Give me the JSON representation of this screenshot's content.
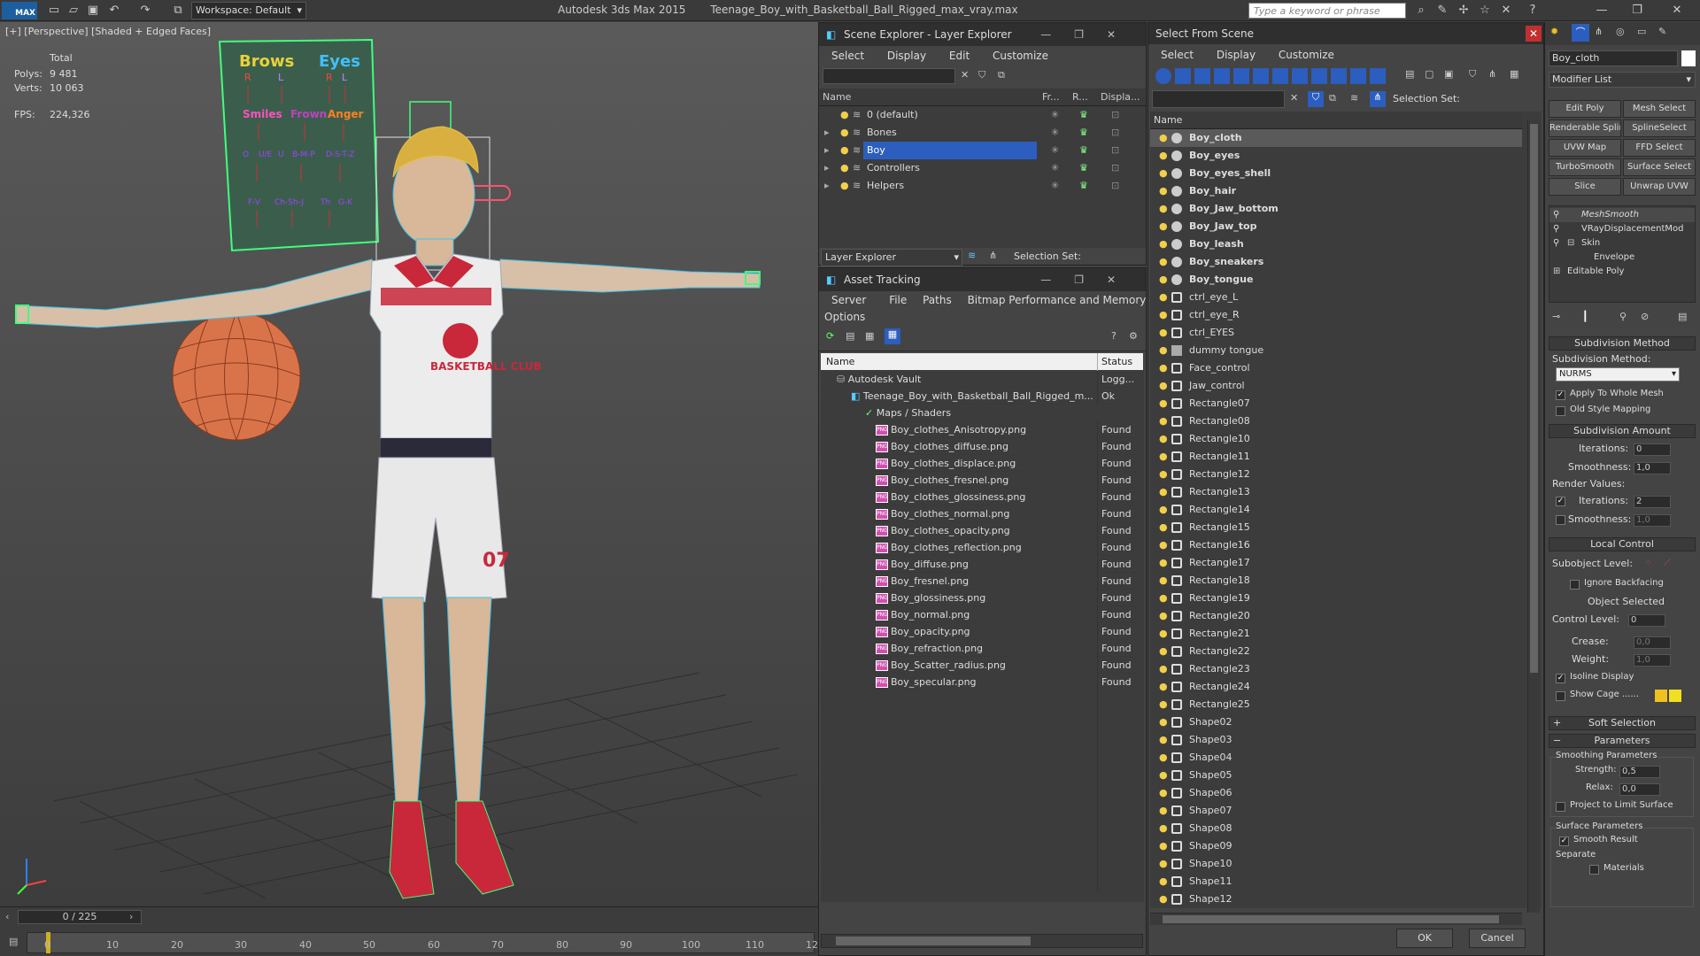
{
  "app": {
    "logo": "MAX",
    "title": "Autodesk 3ds Max  2015",
    "filename": "Teenage_Boy_with_Basketball_Ball_Rigged_max_vray.max",
    "workspace": "Workspace: Default",
    "search_placeholder": "Type a keyword or phrase"
  },
  "viewport": {
    "label": "[+] [Perspective] [Shaded + Edged Faces]",
    "stats": {
      "total_label": "Total",
      "polys_label": "Polys:",
      "polys_value": "9 481",
      "verts_label": "Verts:",
      "verts_value": "10 063",
      "fps_label": "FPS:",
      "fps_value": "224,326"
    },
    "face_board": {
      "brows": "Brows",
      "eyes": "Eyes",
      "r1": "R",
      "l1": "L",
      "r2": "R",
      "l2": "L",
      "smiles": "Smiles",
      "frown": "Frown",
      "anger": "Anger",
      "phon1": "O",
      "phon2": "U/E",
      "phon3": "U",
      "phon4": "B-M-P",
      "phon5": "D-S-T-Z",
      "phon6": "F-V",
      "phon7": "Ch-Sh-J",
      "phon8": "Th",
      "phon9": "G-K"
    },
    "shirt_text": "BASKETBALL CLUB",
    "shorts_number": "07"
  },
  "timeline": {
    "slider": "0 / 225",
    "ticks": [
      "0",
      "10",
      "20",
      "30",
      "40",
      "50",
      "60",
      "70",
      "80",
      "90",
      "100",
      "110",
      "12"
    ]
  },
  "scene_explorer": {
    "title": "Scene Explorer - Layer Explorer",
    "menu": [
      "Select",
      "Display",
      "Edit",
      "Customize"
    ],
    "columns": [
      "Name",
      "Fr...",
      "R...",
      "Displa..."
    ],
    "layers": [
      {
        "name": "0 (default)",
        "selected": false
      },
      {
        "name": "Bones",
        "selected": false
      },
      {
        "name": "Boy",
        "selected": true
      },
      {
        "name": "Controllers",
        "selected": false
      },
      {
        "name": "Helpers",
        "selected": false
      }
    ],
    "footer_dropdown": "Layer Explorer",
    "footer_selection": "Selection Set:"
  },
  "asset_tracking": {
    "title": "Asset Tracking",
    "menu": [
      "Server",
      "File",
      "Paths",
      "Bitmap Performance and Memory"
    ],
    "menu2": "Options",
    "columns": [
      "Name",
      "Status"
    ],
    "rows": [
      {
        "name": "Autodesk Vault",
        "status": "Logg...",
        "indent": 0,
        "type": "vault"
      },
      {
        "name": "Teenage_Boy_with_Basketball_Ball_Rigged_m...",
        "status": "Ok",
        "indent": 1,
        "type": "max"
      },
      {
        "name": "Maps / Shaders",
        "status": "",
        "indent": 2,
        "type": "folder"
      },
      {
        "name": "Boy_clothes_Anisotropy.png",
        "status": "Found",
        "indent": 3,
        "type": "png"
      },
      {
        "name": "Boy_clothes_diffuse.png",
        "status": "Found",
        "indent": 3,
        "type": "png"
      },
      {
        "name": "Boy_clothes_displace.png",
        "status": "Found",
        "indent": 3,
        "type": "png"
      },
      {
        "name": "Boy_clothes_fresnel.png",
        "status": "Found",
        "indent": 3,
        "type": "png"
      },
      {
        "name": "Boy_clothes_glossiness.png",
        "status": "Found",
        "indent": 3,
        "type": "png"
      },
      {
        "name": "Boy_clothes_normal.png",
        "status": "Found",
        "indent": 3,
        "type": "png"
      },
      {
        "name": "Boy_clothes_opacity.png",
        "status": "Found",
        "indent": 3,
        "type": "png"
      },
      {
        "name": "Boy_clothes_reflection.png",
        "status": "Found",
        "indent": 3,
        "type": "png"
      },
      {
        "name": "Boy_diffuse.png",
        "status": "Found",
        "indent": 3,
        "type": "png"
      },
      {
        "name": "Boy_fresnel.png",
        "status": "Found",
        "indent": 3,
        "type": "png"
      },
      {
        "name": "Boy_glossiness.png",
        "status": "Found",
        "indent": 3,
        "type": "png"
      },
      {
        "name": "Boy_normal.png",
        "status": "Found",
        "indent": 3,
        "type": "png"
      },
      {
        "name": "Boy_opacity.png",
        "status": "Found",
        "indent": 3,
        "type": "png"
      },
      {
        "name": "Boy_refraction.png",
        "status": "Found",
        "indent": 3,
        "type": "png"
      },
      {
        "name": "Boy_Scatter_radius.png",
        "status": "Found",
        "indent": 3,
        "type": "png"
      },
      {
        "name": "Boy_specular.png",
        "status": "Found",
        "indent": 3,
        "type": "png"
      }
    ]
  },
  "select_from_scene": {
    "title": "Select From Scene",
    "menu": [
      "Select",
      "Display",
      "Customize"
    ],
    "selection_set": "Selection Set:",
    "column": "Name",
    "items": [
      {
        "name": "Boy_cloth",
        "bold": true,
        "kind": "mesh",
        "selected": true
      },
      {
        "name": "Boy_eyes",
        "bold": true,
        "kind": "mesh"
      },
      {
        "name": "Boy_eyes_shell",
        "bold": true,
        "kind": "mesh"
      },
      {
        "name": "Boy_hair",
        "bold": true,
        "kind": "mesh"
      },
      {
        "name": "Boy_Jaw_bottom",
        "bold": true,
        "kind": "mesh"
      },
      {
        "name": "Boy_Jaw_top",
        "bold": true,
        "kind": "mesh"
      },
      {
        "name": "Boy_leash",
        "bold": true,
        "kind": "mesh"
      },
      {
        "name": "Boy_sneakers",
        "bold": true,
        "kind": "mesh"
      },
      {
        "name": "Boy_tongue",
        "bold": true,
        "kind": "mesh"
      },
      {
        "name": "ctrl_eye_L",
        "kind": "shape"
      },
      {
        "name": "ctrl_eye_R",
        "kind": "shape"
      },
      {
        "name": "ctrl_EYES",
        "kind": "shape"
      },
      {
        "name": "dummy tongue",
        "kind": "helper"
      },
      {
        "name": "Face_control",
        "kind": "shape"
      },
      {
        "name": "Jaw_control",
        "kind": "shape"
      },
      {
        "name": "Rectangle07",
        "kind": "shape"
      },
      {
        "name": "Rectangle08",
        "kind": "shape"
      },
      {
        "name": "Rectangle10",
        "kind": "shape"
      },
      {
        "name": "Rectangle11",
        "kind": "shape"
      },
      {
        "name": "Rectangle12",
        "kind": "shape"
      },
      {
        "name": "Rectangle13",
        "kind": "shape"
      },
      {
        "name": "Rectangle14",
        "kind": "shape"
      },
      {
        "name": "Rectangle15",
        "kind": "shape"
      },
      {
        "name": "Rectangle16",
        "kind": "shape"
      },
      {
        "name": "Rectangle17",
        "kind": "shape"
      },
      {
        "name": "Rectangle18",
        "kind": "shape"
      },
      {
        "name": "Rectangle19",
        "kind": "shape"
      },
      {
        "name": "Rectangle20",
        "kind": "shape"
      },
      {
        "name": "Rectangle21",
        "kind": "shape"
      },
      {
        "name": "Rectangle22",
        "kind": "shape"
      },
      {
        "name": "Rectangle23",
        "kind": "shape"
      },
      {
        "name": "Rectangle24",
        "kind": "shape"
      },
      {
        "name": "Rectangle25",
        "kind": "shape"
      },
      {
        "name": "Shape02",
        "kind": "shape"
      },
      {
        "name": "Shape03",
        "kind": "shape"
      },
      {
        "name": "Shape04",
        "kind": "shape"
      },
      {
        "name": "Shape05",
        "kind": "shape"
      },
      {
        "name": "Shape06",
        "kind": "shape"
      },
      {
        "name": "Shape07",
        "kind": "shape"
      },
      {
        "name": "Shape08",
        "kind": "shape"
      },
      {
        "name": "Shape09",
        "kind": "shape"
      },
      {
        "name": "Shape10",
        "kind": "shape"
      },
      {
        "name": "Shape11",
        "kind": "shape"
      },
      {
        "name": "Shape12",
        "kind": "shape"
      }
    ],
    "ok": "OK",
    "cancel": "Cancel"
  },
  "command_panel": {
    "object_name": "Boy_cloth",
    "modifier_list": "Modifier List",
    "buttons": [
      "Edit Poly",
      "Mesh Select",
      "Renderable Spline",
      "SplineSelect",
      "UVW Map",
      "FFD Select",
      "TurboSmooth",
      "Surface Select",
      "Slice",
      "Unwrap UVW"
    ],
    "stack": [
      "MeshSmooth",
      "VRayDisplacementMod",
      "Skin",
      "Envelope",
      "Editable Poly"
    ],
    "subdivision_method": {
      "header": "Subdivision Method",
      "label": "Subdivision Method:",
      "value": "NURMS",
      "apply_whole": "Apply To Whole Mesh",
      "old_style": "Old Style Mapping"
    },
    "subdivision_amount": {
      "header": "Subdivision Amount",
      "iterations_label": "Iterations:",
      "iterations": "0",
      "smoothness_label": "Smoothness:",
      "smoothness": "1,0",
      "render_values": "Render Values:",
      "r_iterations_label": "Iterations:",
      "r_iterations": "2",
      "r_smoothness_label": "Smoothness:",
      "r_smoothness": "1,0"
    },
    "local_control": {
      "header": "Local Control",
      "subobject_label": "Subobject Level:",
      "ignore_backfacing": "Ignore Backfacing",
      "object_selected": "Object Selected",
      "control_level_label": "Control Level:",
      "control_level": "0",
      "crease_label": "Crease:",
      "crease": "0,0",
      "weight_label": "Weight:",
      "weight": "1,0",
      "isoline": "Isoline Display",
      "show_cage": "Show Cage ......",
      "cage_color1": "#f0c020",
      "cage_color2": "#f0e020"
    },
    "soft_selection": {
      "header": "Soft Selection"
    },
    "parameters": {
      "header": "Parameters",
      "smoothing_params": "Smoothing Parameters",
      "strength_label": "Strength:",
      "strength": "0,5",
      "relax_label": "Relax:",
      "relax": "0,0",
      "project_limit": "Project to Limit Surface",
      "surface_params": "Surface Parameters",
      "smooth_result": "Smooth Result",
      "separate": "Separate",
      "materials": "Materials"
    }
  }
}
